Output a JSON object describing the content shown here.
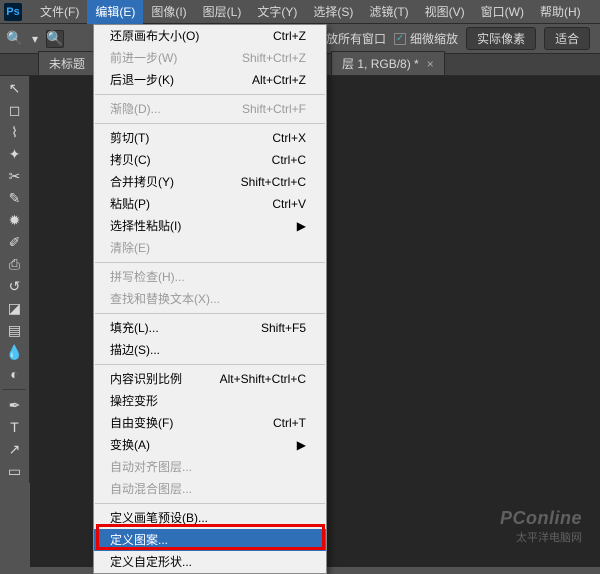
{
  "menubar": {
    "items": [
      {
        "label": "文件(F)"
      },
      {
        "label": "编辑(E)"
      },
      {
        "label": "图像(I)"
      },
      {
        "label": "图层(L)"
      },
      {
        "label": "文字(Y)"
      },
      {
        "label": "选择(S)"
      },
      {
        "label": "滤镜(T)"
      },
      {
        "label": "视图(V)"
      },
      {
        "label": "窗口(W)"
      },
      {
        "label": "帮助(H)"
      }
    ]
  },
  "optbar": {
    "fit_all": "放所有窗口",
    "scrubby": "细微缩放",
    "actual": "实际像素",
    "fit": "适合"
  },
  "tabs": [
    {
      "label": "未标题"
    },
    {
      "label": "层 1, RGB/8) *"
    }
  ],
  "dropdown": [
    {
      "label": "还原画布大小(O)",
      "short": "Ctrl+Z"
    },
    {
      "label": "前进一步(W)",
      "short": "Shift+Ctrl+Z",
      "disabled": true
    },
    {
      "label": "后退一步(K)",
      "short": "Alt+Ctrl+Z"
    },
    {
      "sep": true
    },
    {
      "label": "渐隐(D)...",
      "short": "Shift+Ctrl+F",
      "disabled": true
    },
    {
      "sep": true
    },
    {
      "label": "剪切(T)",
      "short": "Ctrl+X"
    },
    {
      "label": "拷贝(C)",
      "short": "Ctrl+C"
    },
    {
      "label": "合并拷贝(Y)",
      "short": "Shift+Ctrl+C"
    },
    {
      "label": "粘贴(P)",
      "short": "Ctrl+V"
    },
    {
      "label": "选择性粘贴(I)",
      "sub": true
    },
    {
      "label": "清除(E)",
      "disabled": true
    },
    {
      "sep": true
    },
    {
      "label": "拼写检查(H)...",
      "disabled": true
    },
    {
      "label": "查找和替换文本(X)...",
      "disabled": true
    },
    {
      "sep": true
    },
    {
      "label": "填充(L)...",
      "short": "Shift+F5"
    },
    {
      "label": "描边(S)..."
    },
    {
      "sep": true
    },
    {
      "label": "内容识别比例",
      "short": "Alt+Shift+Ctrl+C"
    },
    {
      "label": "操控变形"
    },
    {
      "label": "自由变换(F)",
      "short": "Ctrl+T"
    },
    {
      "label": "变换(A)",
      "sub": true
    },
    {
      "label": "自动对齐图层...",
      "disabled": true
    },
    {
      "label": "自动混合图层...",
      "disabled": true
    },
    {
      "sep": true
    },
    {
      "label": "定义画笔预设(B)..."
    },
    {
      "label": "定义图案...",
      "highlight": true
    },
    {
      "label": "定义自定形状..."
    }
  ],
  "watermark": {
    "l1": "PConline",
    "l2": "太平洋电脑网"
  }
}
